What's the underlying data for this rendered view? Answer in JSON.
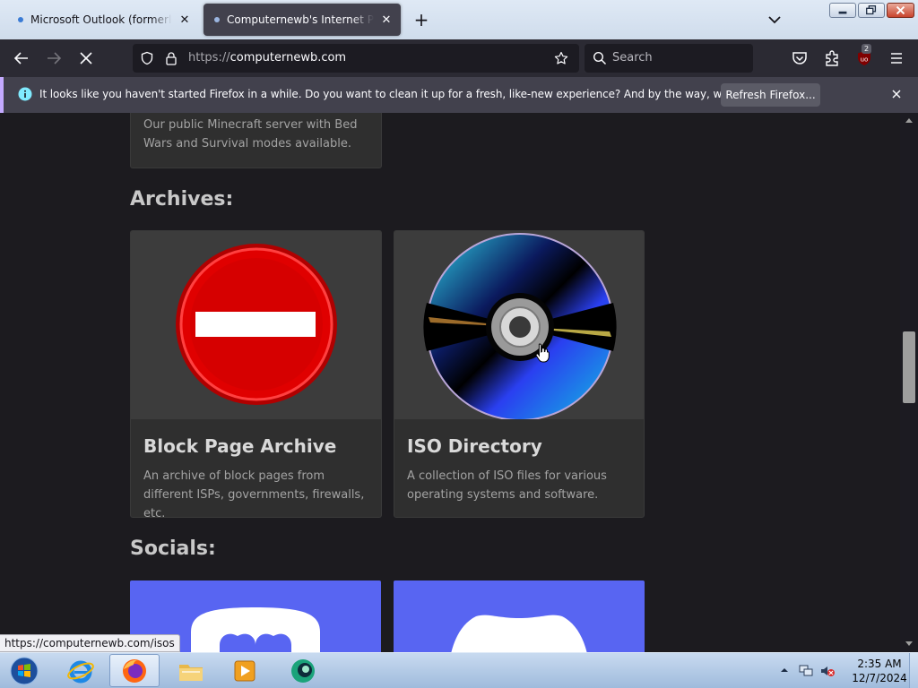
{
  "browser": {
    "tabs": [
      {
        "title": "Microsoft Outlook (formerly Ha",
        "active": false
      },
      {
        "title": "Computernewb's Internet Pub",
        "active": true
      }
    ],
    "url_protocol": "https://",
    "url_host": "computernewb.com",
    "search_placeholder": "Search",
    "extension_badge": "2"
  },
  "notification": {
    "text": "It looks like you haven't started Firefox in a while. Do you want to clean it up for a fresh, like-new experience? And by the way, welcome back!",
    "button": "Refresh Firefox..."
  },
  "page": {
    "previous_card": {
      "description": "Our public Minecraft server with Bed Wars and Survival modes available."
    },
    "archives_heading": "Archives:",
    "archive_cards": [
      {
        "title": "Block Page Archive",
        "description": "An archive of block pages from different ISPs, governments, firewalls, etc.",
        "icon": "no-entry-sign"
      },
      {
        "title": "ISO Directory",
        "description": "A collection of ISO files for various operating systems and software.",
        "icon": "cd-disc"
      }
    ],
    "socials_heading": "Socials:",
    "social_cards": [
      {
        "icon": "mastodon-logo"
      },
      {
        "icon": "discord-logo"
      }
    ]
  },
  "status_bar": {
    "url": "https://computernewb.com/isos"
  },
  "taskbar": {
    "apps": [
      "start-orb",
      "internet-explorer",
      "firefox",
      "explorer",
      "media-player",
      "app-icon"
    ],
    "time": "2:35 AM",
    "date": "12/7/2024"
  },
  "colors": {
    "accent_notification": "#c4aaff",
    "social_bg": "#5865f2",
    "no_entry_red": "#e00000"
  }
}
